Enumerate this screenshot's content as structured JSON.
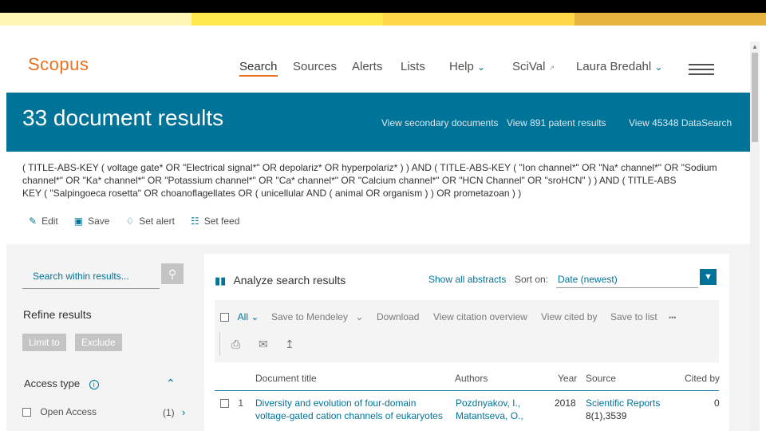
{
  "app": {
    "logo": "Scopus"
  },
  "nav": {
    "search": "Search",
    "sources": "Sources",
    "alerts": "Alerts",
    "lists": "Lists",
    "help": "Help",
    "scival": "SciVal",
    "user": "Laura Bredahl"
  },
  "banner": {
    "title": "33 document results",
    "secondary": "View secondary documents",
    "patent": "View 891 patent results",
    "dataset": "View 45348 DataSearch"
  },
  "query": {
    "line1": "( TITLE-ABS-KEY ( voltage gate* OR \"Electrical signal*\" OR depolariz* OR hyperpolariz* ) ) AND ( TITLE-ABS-KEY ( \"Ion channel*\" OR \"Na* channel*\" OR \"Sodium",
    "line2": "channel*\" OR \"Ka* channel*\" OR \"Potassium channel*\" OR \"Ca* channel*\" OR \"Calcium channel*\" OR \"HCN Channel\" OR \"sroHCN\" ) ) AND ( TITLE-ABS",
    "line3": "KEY ( \"Salpingoeca rosetta\" OR choanoflagellates OR ( unicellular AND ( animal OR organism ) ) OR prometazoan ) )"
  },
  "actions": {
    "edit": "Edit",
    "save": "Save",
    "alert": "Set alert",
    "feed": "Set feed"
  },
  "left": {
    "search_placeholder": "Search within results...",
    "refine": "Refine results",
    "limit": "Limit to",
    "exclude": "Exclude",
    "access_type": "Access type",
    "open_access": "Open Access",
    "open_access_count": "(1)"
  },
  "results": {
    "analyze": "Analyze search results",
    "show_abstracts": "Show all abstracts",
    "sort_on": "Sort on:",
    "sort_value": "Date (newest)",
    "toolbar": {
      "all": "All",
      "mendeley": "Save to Mendeley",
      "download": "Download",
      "citation_overview": "View citation overview",
      "cited_by": "View cited by",
      "save_list": "Save to list",
      "more": "•••"
    },
    "headers": {
      "title": "Document title",
      "authors": "Authors",
      "year": "Year",
      "source": "Source",
      "cited": "Cited by"
    },
    "row1": {
      "num": "1",
      "title1": "Diversity and evolution of four-domain",
      "title2": "voltage-gated cation channels of eukaryotes",
      "author1": "Pozdnyakov, I.,",
      "author2": "Matantseva, O.,",
      "year": "2018",
      "source1": "Scientific Reports",
      "source2": "8(1),3539",
      "cited": "0"
    }
  },
  "colors": {
    "brand": "#e9711c",
    "primary": "#007398"
  }
}
